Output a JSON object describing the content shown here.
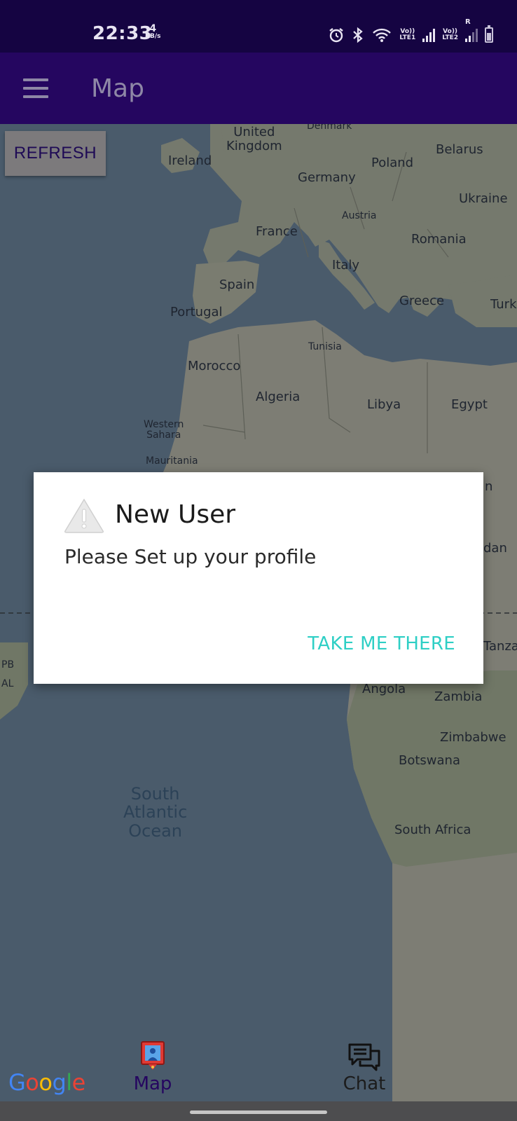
{
  "status_bar": {
    "time": "22:33",
    "net_speed_value": "4",
    "net_speed_unit": "KB/s",
    "sim1_label_top": "Vo))",
    "sim1_label_bottom": "LTE1",
    "sim2_label_top": "Vo))",
    "sim2_label_bottom": "LTE2",
    "roaming": "R",
    "icons": [
      "alarm-icon",
      "bluetooth-icon",
      "wifi-icon",
      "signal-icon",
      "signal-icon",
      "battery-icon"
    ]
  },
  "app_bar": {
    "title": "Map",
    "menu_icon": "hamburger-menu-icon"
  },
  "map": {
    "refresh_label": "REFRESH",
    "labels": {
      "denmark": "Denmark",
      "uk": "United\nKingdom",
      "ireland": "Ireland",
      "belarus": "Belarus",
      "poland": "Poland",
      "germany": "Germany",
      "ukraine": "Ukraine",
      "austria": "Austria",
      "france": "France",
      "romania": "Romania",
      "italy": "Italy",
      "spain": "Spain",
      "portugal": "Portugal",
      "greece": "Greece",
      "turkey": "Turk",
      "tunisia": "Tunisia",
      "morocco": "Morocco",
      "algeria": "Algeria",
      "libya": "Libya",
      "egypt": "Egypt",
      "western_sahara": "Western\nSahara",
      "mauritania": "Mauritania",
      "chad_cut": "n",
      "sudan_cut": "dan",
      "tanzania_cut": "Tanza",
      "pb": "PB",
      "al": "AL",
      "angola": "Angola",
      "zambia": "Zambia",
      "zimbabwe": "Zimbabwe",
      "botswana": "Botswana",
      "south_africa": "South Africa",
      "ocean": "South\nAtlantic\nOcean"
    },
    "google_logo": "Google",
    "google_colors": [
      "#4285F4",
      "#EA4335",
      "#FBBC05",
      "#4285F4",
      "#34A853",
      "#EA4335"
    ]
  },
  "dialog": {
    "icon": "warning-icon",
    "title": "New User",
    "message": "Please Set up your profile",
    "action_label": "TAKE ME THERE",
    "action_color": "#2ecfc5"
  },
  "bottom_nav": {
    "items": [
      {
        "label": "Map",
        "icon": "map-pin-icon",
        "active": true,
        "color": "#250660"
      },
      {
        "label": "Chat",
        "icon": "chat-bubbles-icon",
        "active": false,
        "color": "#1c1c1c"
      }
    ]
  }
}
